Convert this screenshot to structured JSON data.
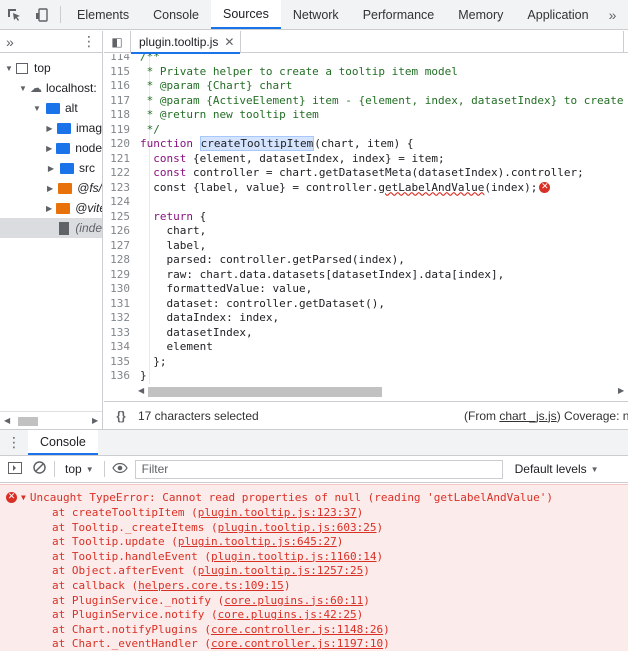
{
  "toolbar": {
    "inspect_icon": "inspect-element-icon",
    "device_icon": "device-toolbar-icon",
    "tabs": [
      "Elements",
      "Console",
      "Sources",
      "Network",
      "Performance",
      "Memory",
      "Application"
    ],
    "active_tab": "Sources",
    "more": "»"
  },
  "navigator": {
    "more": "»",
    "menu": "⋮",
    "tree": [
      {
        "label": "top",
        "depth": 0,
        "icon": "frame",
        "expanded": true
      },
      {
        "label": "localhost:",
        "depth": 1,
        "icon": "cloud",
        "expanded": true
      },
      {
        "label": "alt",
        "depth": 2,
        "icon": "folder-blue",
        "expanded": true
      },
      {
        "label": "imag",
        "depth": 3,
        "icon": "folder-blue",
        "expanded": false
      },
      {
        "label": "node",
        "depth": 3,
        "icon": "folder-blue",
        "expanded": false
      },
      {
        "label": "src",
        "depth": 3,
        "icon": "folder-blue",
        "expanded": false
      },
      {
        "label": "@fs/",
        "depth": 3,
        "icon": "folder-orange",
        "expanded": false
      },
      {
        "label": "@vite",
        "depth": 3,
        "icon": "folder-orange",
        "expanded": false
      },
      {
        "label": "(inde",
        "depth": 3,
        "icon": "file",
        "selected": true
      }
    ]
  },
  "editor": {
    "sidebar_toggle": "◧",
    "file_tab": "plugin.tooltip.js",
    "close": "✕",
    "lines": [
      {
        "n": "114",
        "text": "/**",
        "cls": "comment"
      },
      {
        "n": "115",
        "text": " * Private helper to create a tooltip item model",
        "cls": "comment"
      },
      {
        "n": "116",
        "text": " * @param {Chart} chart",
        "cls": "comment"
      },
      {
        "n": "117",
        "text": " * @param {ActiveElement} item - {element, index, datasetIndex} to create the tooltip",
        "cls": "comment"
      },
      {
        "n": "118",
        "text": " * @return new tooltip item",
        "cls": "comment"
      },
      {
        "n": "119",
        "text": " */",
        "cls": "comment"
      },
      {
        "n": "120",
        "text": "",
        "cls": "fnline"
      },
      {
        "n": "121",
        "text": "  const {element, datasetIndex, index} = item;",
        "cls": ""
      },
      {
        "n": "122",
        "text": "  const controller = chart.getDatasetMeta(datasetIndex).controller;",
        "cls": ""
      },
      {
        "n": "123",
        "text": "",
        "cls": "errline"
      },
      {
        "n": "124",
        "text": "",
        "cls": ""
      },
      {
        "n": "125",
        "text": "  return {",
        "cls": ""
      },
      {
        "n": "126",
        "text": "    chart,",
        "cls": ""
      },
      {
        "n": "127",
        "text": "    label,",
        "cls": ""
      },
      {
        "n": "128",
        "text": "    parsed: controller.getParsed(index),",
        "cls": ""
      },
      {
        "n": "129",
        "text": "    raw: chart.data.datasets[datasetIndex].data[index],",
        "cls": ""
      },
      {
        "n": "130",
        "text": "    formattedValue: value,",
        "cls": ""
      },
      {
        "n": "131",
        "text": "    dataset: controller.getDataset(),",
        "cls": ""
      },
      {
        "n": "132",
        "text": "    dataIndex: index,",
        "cls": ""
      },
      {
        "n": "133",
        "text": "    datasetIndex,",
        "cls": ""
      },
      {
        "n": "134",
        "text": "    element",
        "cls": ""
      },
      {
        "n": "135",
        "text": "  };",
        "cls": ""
      },
      {
        "n": "136",
        "text": "}",
        "cls": ""
      }
    ],
    "fn_line": {
      "kw": "function",
      "name": "createTooltipItem",
      "rest": "(chart, item) {"
    },
    "err_line": {
      "pre": "  const {label, value} = controller.",
      "err": "getLabelAndValue",
      "post": "(index);"
    },
    "status": {
      "braces": "{}",
      "selected": "17 characters selected",
      "from_pre": "(From ",
      "from_link": "chart _js.js",
      "from_post": ")",
      "coverage": "Coverage: n/a"
    }
  },
  "drawer": {
    "menu": "⋮",
    "tab": "Console"
  },
  "console_toolbar": {
    "context": "top",
    "filter_placeholder": "Filter",
    "levels": "Default levels"
  },
  "error": {
    "message": "Uncaught TypeError: Cannot read properties of null (reading 'getLabelAndValue')",
    "frames": [
      {
        "fn": "at createTooltipItem",
        "loc": "plugin.tooltip.js:123:37"
      },
      {
        "fn": "at Tooltip._createItems",
        "loc": "plugin.tooltip.js:603:25"
      },
      {
        "fn": "at Tooltip.update",
        "loc": "plugin.tooltip.js:645:27"
      },
      {
        "fn": "at Tooltip.handleEvent",
        "loc": "plugin.tooltip.js:1160:14"
      },
      {
        "fn": "at Object.afterEvent",
        "loc": "plugin.tooltip.js:1257:25"
      },
      {
        "fn": "at callback",
        "loc": "helpers.core.ts:109:15"
      },
      {
        "fn": "at PluginService._notify",
        "loc": "core.plugins.js:60:11"
      },
      {
        "fn": "at PluginService.notify",
        "loc": "core.plugins.js:42:25"
      },
      {
        "fn": "at Chart.notifyPlugins",
        "loc": "core.controller.js:1148:26"
      },
      {
        "fn": "at Chart._eventHandler",
        "loc": "core.controller.js:1197:10"
      }
    ]
  }
}
